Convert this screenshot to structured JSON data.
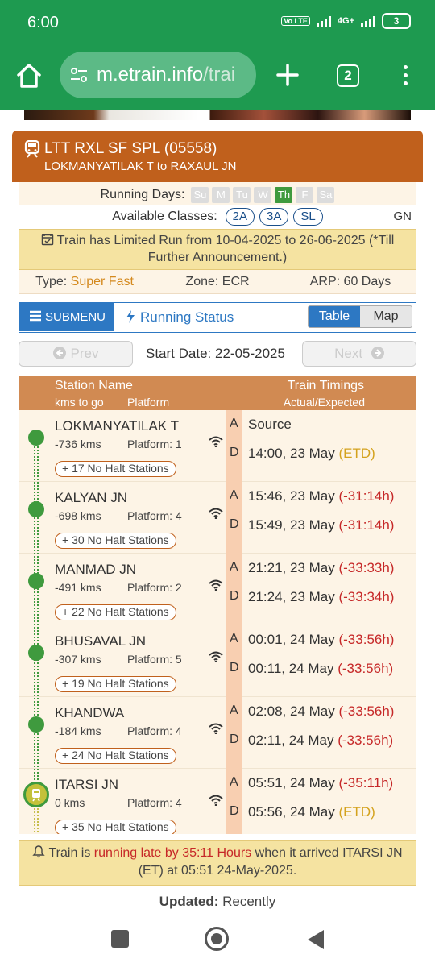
{
  "status_bar": {
    "time": "6:00",
    "network": "4G+",
    "volte": "Vo LTE",
    "battery": "3"
  },
  "browser": {
    "url_main": "m.etrain.info",
    "url_rest": "/trai",
    "tab_count": "2"
  },
  "train": {
    "name": "LTT RXL SF SPL (05558)",
    "route": "LOKMANYATILAK T to RAXAUL JN",
    "running_days_label": "Running Days:",
    "days": [
      {
        "label": "Su",
        "active": false
      },
      {
        "label": "M",
        "active": false
      },
      {
        "label": "Tu",
        "active": false
      },
      {
        "label": "W",
        "active": false
      },
      {
        "label": "Th",
        "active": true
      },
      {
        "label": "F",
        "active": false
      },
      {
        "label": "Sa",
        "active": false
      }
    ],
    "classes_label": "Available Classes:",
    "classes": [
      "2A",
      "3A",
      "SL"
    ],
    "quota": "GN",
    "limited_run": "Train has Limited Run from 10-04-2025 to 26-06-2025 (*Till Further Announcement.)",
    "type_label": "Type:",
    "type_value": "Super Fast",
    "zone": "Zone: ECR",
    "arp": "ARP: 60 Days"
  },
  "nav": {
    "submenu_label": "SUBMENU",
    "running_status_label": "Running Status",
    "view_table": "Table",
    "view_map": "Map",
    "prev_label": "Prev",
    "next_label": "Next",
    "start_date_label": "Start Date:",
    "start_date_value": "22-05-2025"
  },
  "table_header": {
    "station_name": "Station Name",
    "kms_to_go": "kms to go",
    "platform": "Platform",
    "train_timings": "Train Timings",
    "actual_expected": "Actual/Expected"
  },
  "stations": [
    {
      "name": "LOKMANYATILAK T",
      "kms": "-736 kms",
      "platform": "Platform: 1",
      "halt": "+ 17 No Halt Stations",
      "arr": "Source",
      "arr_delay": "",
      "dep": "14:00, 23 May",
      "dep_delay": "(ETD)"
    },
    {
      "name": "KALYAN JN",
      "kms": "-698 kms",
      "platform": "Platform: 4",
      "halt": "+ 30 No Halt Stations",
      "arr": "15:46, 23 May",
      "arr_delay": "(-31:14h)",
      "dep": "15:49, 23 May",
      "dep_delay": "(-31:14h)"
    },
    {
      "name": "MANMAD JN",
      "kms": "-491 kms",
      "platform": "Platform: 2",
      "halt": "+ 22 No Halt Stations",
      "arr": "21:21, 23 May",
      "arr_delay": "(-33:33h)",
      "dep": "21:24, 23 May",
      "dep_delay": "(-33:34h)"
    },
    {
      "name": "BHUSAVAL JN",
      "kms": "-307 kms",
      "platform": "Platform: 5",
      "halt": "+ 19 No Halt Stations",
      "arr": "00:01, 24 May",
      "arr_delay": "(-33:56h)",
      "dep": "00:11, 24 May",
      "dep_delay": "(-33:56h)"
    },
    {
      "name": "KHANDWA",
      "kms": "-184 kms",
      "platform": "Platform: 4",
      "halt": "+ 24 No Halt Stations",
      "arr": "02:08, 24 May",
      "arr_delay": "(-33:56h)",
      "dep": "02:11, 24 May",
      "dep_delay": "(-33:56h)"
    },
    {
      "name": "ITARSI JN",
      "kms": "0 kms",
      "platform": "Platform: 4",
      "halt": "+ 35 No Halt Stations",
      "arr": "05:51, 24 May",
      "arr_delay": "(-35:11h)",
      "dep": "05:56, 24 May",
      "dep_delay": "(ETD)"
    }
  ],
  "alert": {
    "prefix": "Train is",
    "highlight": "running late by 35:11 Hours",
    "suffix": "when it arrived ITARSI JN (ET) at 05:51 24-May-2025."
  },
  "updated": {
    "label": "Updated:",
    "value": "Recently"
  }
}
